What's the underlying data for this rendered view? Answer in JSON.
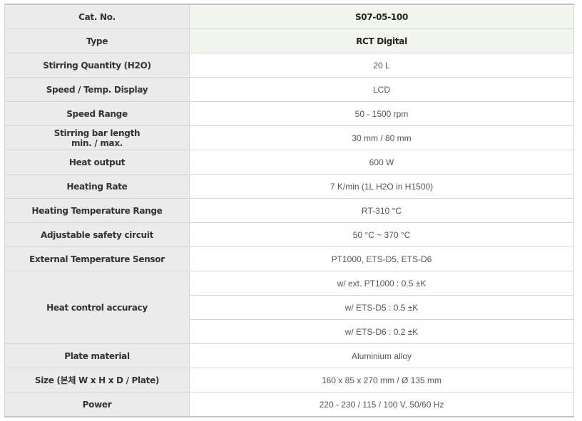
{
  "table": {
    "rows": [
      {
        "label": "Cat. No.",
        "value": "S07-05-100"
      },
      {
        "label": "Type",
        "value": "RCT Digital"
      },
      {
        "label": "Stirring Quantity (H2O)",
        "value": "20 L"
      },
      {
        "label": "Speed / Temp. Display",
        "value": "LCD"
      },
      {
        "label": "Speed Range",
        "value": "50 - 1500 rpm"
      },
      {
        "label_line1": "Stirring bar length",
        "label_line2": "min. / max.",
        "value": "30 mm / 80 mm"
      },
      {
        "label": "Heat output",
        "value": "600 W"
      },
      {
        "label": "Heating Rate",
        "value": "7 K/min (1L H2O in H1500)"
      },
      {
        "label": "Heating Temperature Range",
        "value": "RT-310 °C"
      },
      {
        "label": "Adjustable safety circuit",
        "value": "50 °C ~ 370 °C"
      },
      {
        "label": "External Temperature Sensor",
        "value": "PT1000, ETS-D5, ETS-D6"
      },
      {
        "label": "Heat control accuracy",
        "values": [
          "w/ ext. PT1000 : 0.5 ±K",
          "w/ ETS-D5 : 0.5 ±K",
          "w/ ETS-D6 : 0.2 ±K"
        ]
      },
      {
        "label": "Plate material",
        "value": "Aluminium alloy"
      },
      {
        "label": "Size (본체 W x H x D / Plate)",
        "value": "160 x 85 x 270 mm / Ø 135 mm"
      },
      {
        "label": "Power",
        "value": "220 - 230 / 115 / 100 V, 50/60 Hz"
      }
    ]
  }
}
